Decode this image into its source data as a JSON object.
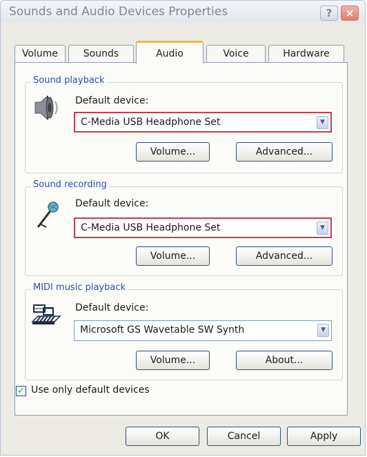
{
  "window": {
    "title": "Sounds and Audio Devices Properties"
  },
  "titlebar": {
    "help_glyph": "?",
    "close_glyph": "×"
  },
  "tabs": [
    {
      "label": "Volume"
    },
    {
      "label": "Sounds"
    },
    {
      "label": "Audio",
      "active": true
    },
    {
      "label": "Voice"
    },
    {
      "label": "Hardware"
    }
  ],
  "playback": {
    "group_title": "Sound playback",
    "icon": "speaker-icon",
    "device_label": "Default device:",
    "selected": "C-Media USB Headphone Set",
    "volume_button": "Volume...",
    "advanced_button": "Advanced..."
  },
  "recording": {
    "group_title": "Sound recording",
    "icon": "microphone-icon",
    "device_label": "Default device:",
    "selected": "C-Media USB Headphone Set",
    "volume_button": "Volume...",
    "advanced_button": "Advanced..."
  },
  "midi": {
    "group_title": "MIDI music playback",
    "icon": "midi-keyboard-icon",
    "device_label": "Default device:",
    "selected": "Microsoft GS Wavetable SW Synth",
    "volume_button": "Volume...",
    "about_button": "About..."
  },
  "options": {
    "use_default_label": "Use only default devices",
    "use_default_checked": true,
    "check_glyph": "✓"
  },
  "footer": {
    "ok": "OK",
    "cancel": "Cancel",
    "apply": "Apply"
  },
  "colors": {
    "highlight_border": "#c0404a",
    "group_title": "#2b4fa8",
    "active_tab_accent": "#f5b94a",
    "button_border": "#2d4f82"
  }
}
